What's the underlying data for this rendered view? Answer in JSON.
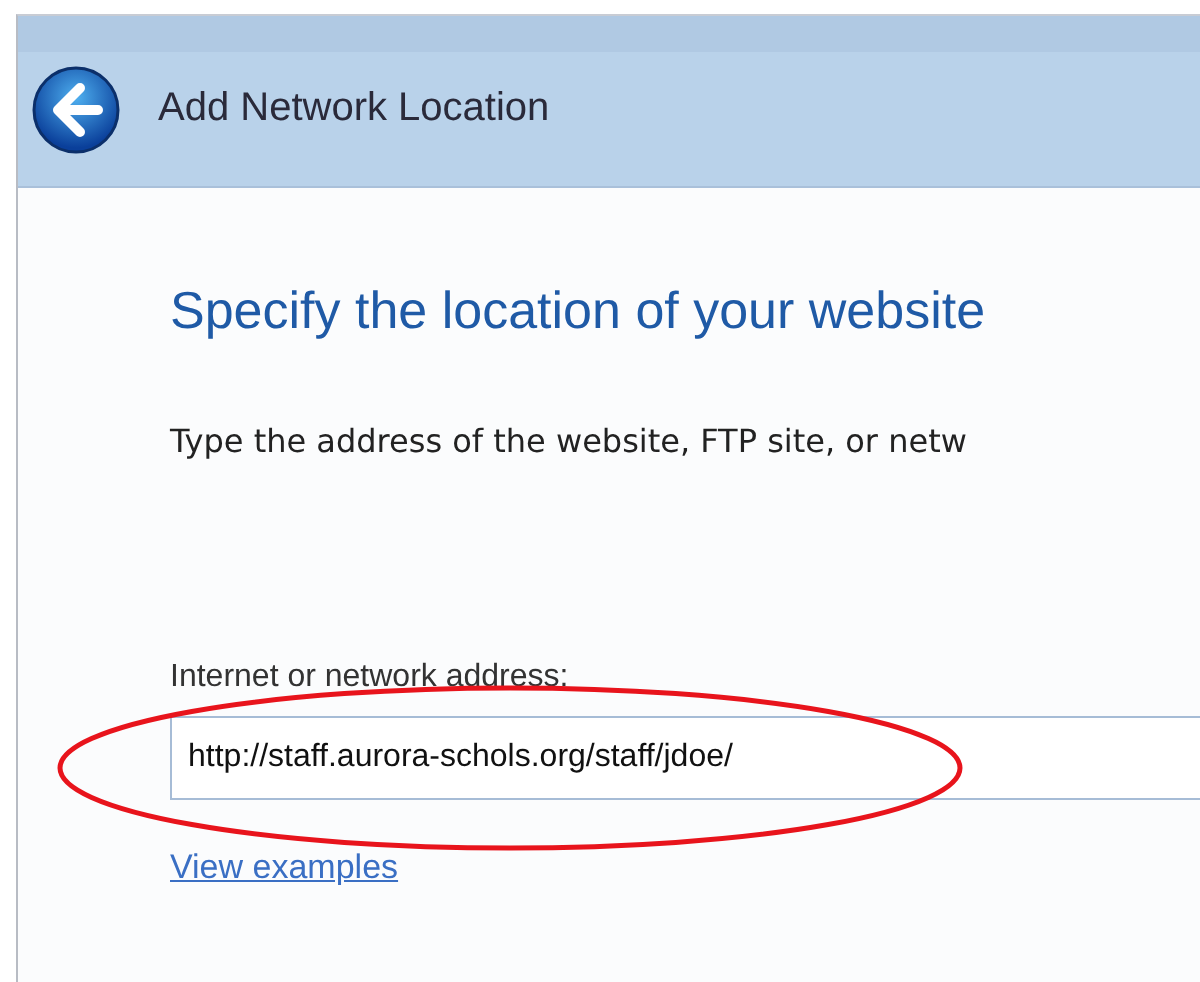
{
  "window": {
    "title": "Add Network Location"
  },
  "page": {
    "heading": "Specify the location of your website",
    "description": "Type the address of the website, FTP site, or netw",
    "address": {
      "label": "Internet or network address:",
      "value": "http://staff.aurora-schols.org/staff/jdoe/"
    },
    "link": "View examples"
  }
}
